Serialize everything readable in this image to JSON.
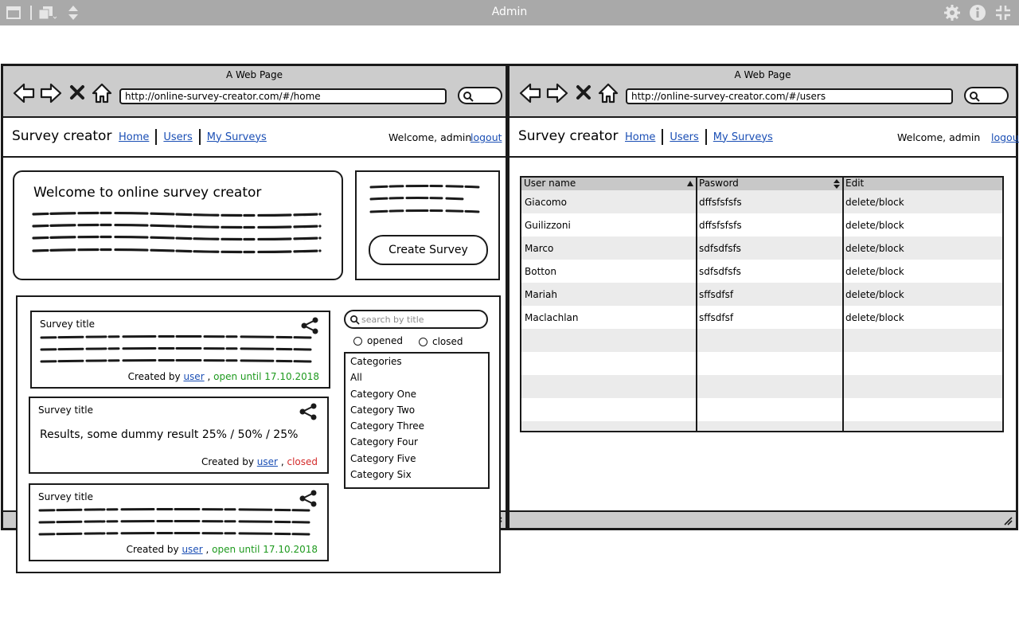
{
  "app": {
    "title": "Admin",
    "icons": [
      "window-icon",
      "copy-icon",
      "sort-icon",
      "gear-icon",
      "info-icon",
      "fullscreen-icon"
    ]
  },
  "left_window": {
    "title": "A Web Page",
    "url": "http://online-survey-creator.com/#/home",
    "brand": "Survey creator",
    "nav": [
      "Home",
      "Users",
      "My Surveys"
    ],
    "welcome_text": "Welcome, admin",
    "logout": "logout",
    "welcome_box_title": "Welcome to online survey creator",
    "create_button": "Create Survey",
    "search_placeholder": "search by title",
    "filters": [
      "opened",
      "closed"
    ],
    "categories": [
      "Categories",
      "All",
      "Category One",
      "Category Two",
      "Category Three",
      "Category Four",
      "Category Five",
      "Category Six"
    ],
    "cards": [
      {
        "title": "Survey title",
        "created_by": "Created by",
        "user": "user",
        "comma": ",",
        "status": "open until 17.10.2018"
      },
      {
        "title": "Survey title",
        "result": "Results, some dummy result 25% / 50% / 25%",
        "created_by": "Created by",
        "user": "user",
        "comma": ",",
        "status": "closed"
      },
      {
        "title": "Survey title",
        "created_by": "Created by",
        "user": "user",
        "comma": ",",
        "status": "open until 17.10.2018"
      }
    ]
  },
  "right_window": {
    "title": "A Web Page",
    "url": "http://online-survey-creator.com/#/users",
    "brand": "Survey creator",
    "nav": [
      "Home",
      "Users",
      "My Surveys"
    ],
    "welcome_text": "Welcome, admin",
    "logout": "logout",
    "table": {
      "headers": [
        "User name",
        "Pasword",
        "Edit"
      ],
      "rows": [
        [
          "Giacomo",
          "dffsfsfsfs",
          "delete/block"
        ],
        [
          "Guilizzoni",
          "dffsfsfsfs",
          "delete/block"
        ],
        [
          "Marco",
          "sdfsdfsfs",
          "delete/block"
        ],
        [
          "Botton",
          "sdfsdfsfs",
          "delete/block"
        ],
        [
          "Mariah",
          "sffsdfsf",
          "delete/block"
        ],
        [
          "Maclachlan",
          "sffsdfsf",
          "delete/block"
        ]
      ]
    }
  },
  "colors": {
    "link": "#1b4fb5",
    "open": "#1e9a1e",
    "closed": "#d42b2b",
    "chrome": "#cccccc",
    "appbar": "#a9a9a9"
  }
}
